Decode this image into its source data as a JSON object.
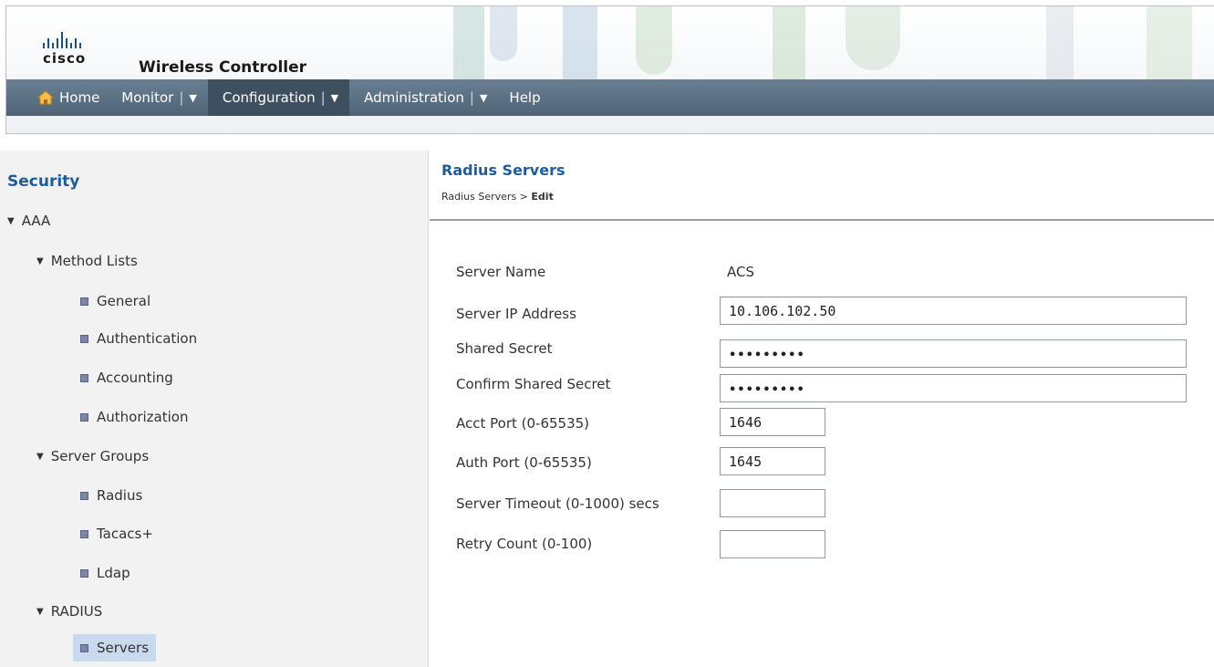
{
  "header": {
    "logo_text": "cisco",
    "product_name": "Wireless Controller"
  },
  "nav": {
    "home": "Home",
    "monitor": "Monitor",
    "configuration": "Configuration",
    "administration": "Administration",
    "help": "Help",
    "separator": "|",
    "dropdown_glyph": "▼"
  },
  "sidebar": {
    "title": "Security",
    "tree": {
      "aaa": "AAA",
      "method_lists": "Method Lists",
      "general": "General",
      "authentication": "Authentication",
      "accounting": "Accounting",
      "authorization": "Authorization",
      "server_groups": "Server Groups",
      "radius": "Radius",
      "tacacs": "Tacacs+",
      "ldap": "Ldap",
      "radius_section": "RADIUS",
      "servers": "Servers"
    },
    "selected_item": "Servers"
  },
  "main": {
    "title": "Radius Servers",
    "breadcrumb_parent": "Radius Servers > ",
    "breadcrumb_current": "Edit",
    "form": {
      "server_name_label": "Server Name",
      "server_name_value": "ACS",
      "server_ip_label": "Server IP Address",
      "server_ip_value": "10.106.102.50",
      "shared_secret_label": "Shared Secret",
      "shared_secret_value": "•••••••••",
      "confirm_secret_label": "Confirm Shared Secret",
      "confirm_secret_value": "•••••••••",
      "acct_port_label": "Acct Port (0-65535)",
      "acct_port_value": "1646",
      "auth_port_label": "Auth Port (0-65535)",
      "auth_port_value": "1645",
      "timeout_label": "Server Timeout (0-1000) secs",
      "timeout_value": "",
      "retry_label": "Retry Count (0-100)",
      "retry_value": ""
    }
  },
  "colors": {
    "accent": "#1f5c99",
    "navbar": "#566a7c",
    "sidebar_bg": "#f2f2f2",
    "selected_bg": "#c9d9ee"
  },
  "icons": [
    "home-icon",
    "chevron-down-icon",
    "triangle-down-icon",
    "square-bullet-icon"
  ]
}
